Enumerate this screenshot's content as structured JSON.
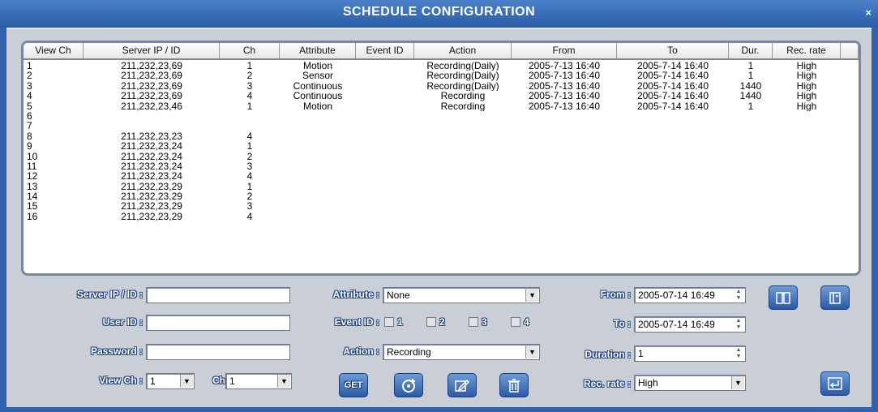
{
  "window": {
    "title": "SCHEDULE CONFIGURATION",
    "close_glyph": "×"
  },
  "table": {
    "columns": [
      "View Ch",
      "Server IP / ID",
      "Ch",
      "Attribute",
      "Event ID",
      "Action",
      "From",
      "To",
      "Dur.",
      "Rec. rate"
    ],
    "rows": [
      [
        "1",
        "211,232,23,69",
        "1",
        "Motion",
        "",
        "Recording(Daily)",
        "2005-7-13 16:40",
        "2005-7-14 16:40",
        "1",
        "High"
      ],
      [
        "2",
        "211,232,23,69",
        "2",
        "Sensor",
        "",
        "Recording(Daily)",
        "2005-7-13 16:40",
        "2005-7-14 16:40",
        "1",
        "High"
      ],
      [
        "3",
        "211,232,23,69",
        "3",
        "Continuous",
        "",
        "Recording(Daily)",
        "2005-7-13 16:40",
        "2005-7-14 16:40",
        "1440",
        "High"
      ],
      [
        "4",
        "211,232,23,69",
        "4",
        "Continuous",
        "",
        "Recording",
        "2005-7-13 16:40",
        "2005-7-14 16:40",
        "1440",
        "High"
      ],
      [
        "5",
        "211,232,23,46",
        "1",
        "Motion",
        "",
        "Recording",
        "2005-7-13 16:40",
        "2005-7-14 16:40",
        "1",
        "High"
      ],
      [
        "6",
        "",
        "",
        "",
        "",
        "",
        "",
        "",
        "",
        ""
      ],
      [
        "7",
        "",
        "",
        "",
        "",
        "",
        "",
        "",
        "",
        ""
      ],
      [
        "8",
        "211,232,23,23",
        "4",
        "",
        "",
        "",
        "",
        "",
        "",
        ""
      ],
      [
        "9",
        "211,232,23,24",
        "1",
        "",
        "",
        "",
        "",
        "",
        "",
        ""
      ],
      [
        "10",
        "211,232,23,24",
        "2",
        "",
        "",
        "",
        "",
        "",
        "",
        ""
      ],
      [
        "11",
        "211,232,23,24",
        "3",
        "",
        "",
        "",
        "",
        "",
        "",
        ""
      ],
      [
        "12",
        "211,232,23,24",
        "4",
        "",
        "",
        "",
        "",
        "",
        "",
        ""
      ],
      [
        "13",
        "211,232,23,29",
        "1",
        "",
        "",
        "",
        "",
        "",
        "",
        ""
      ],
      [
        "14",
        "211,232,23,29",
        "2",
        "",
        "",
        "",
        "",
        "",
        "",
        ""
      ],
      [
        "15",
        "211,232,23,29",
        "3",
        "",
        "",
        "",
        "",
        "",
        "",
        ""
      ],
      [
        "16",
        "211,232,23,29",
        "4",
        "",
        "",
        "",
        "",
        "",
        "",
        ""
      ]
    ]
  },
  "form": {
    "server_ip_label": "Server IP / ID :",
    "server_ip_value": "",
    "user_id_label": "User ID :",
    "user_id_value": "",
    "password_label": "Password :",
    "password_value": "",
    "view_ch_label": "View Ch :",
    "view_ch_value": "1",
    "ch_label": "Ch",
    "ch_value": "1",
    "attribute_label": "Attribute :",
    "attribute_value": "None",
    "event_id_label": "Event ID :",
    "event_ids": [
      "1",
      "2",
      "3",
      "4"
    ],
    "action_label": "Action :",
    "action_value": "Recording",
    "from_label": "From :",
    "from_value": "2005-07-14 16:49",
    "to_label": "To :",
    "to_value": "2005-07-14 16:49",
    "duration_label": "Duration :",
    "duration_value": "1",
    "rec_rate_label": "Rec. rate :",
    "rec_rate_value": "High"
  },
  "buttons": {
    "get_label": "GET",
    "add_icon": "add-disc-icon",
    "edit_icon": "edit-pencil-icon",
    "delete_icon": "trash-icon",
    "open_icon": "open-book-icon",
    "save_icon": "save-book-icon",
    "return_icon": "enter-return-icon"
  },
  "colors": {
    "window_bg": "#2f63ad",
    "panel_bg": "#c9ced7",
    "list_border": "#7488a6"
  }
}
